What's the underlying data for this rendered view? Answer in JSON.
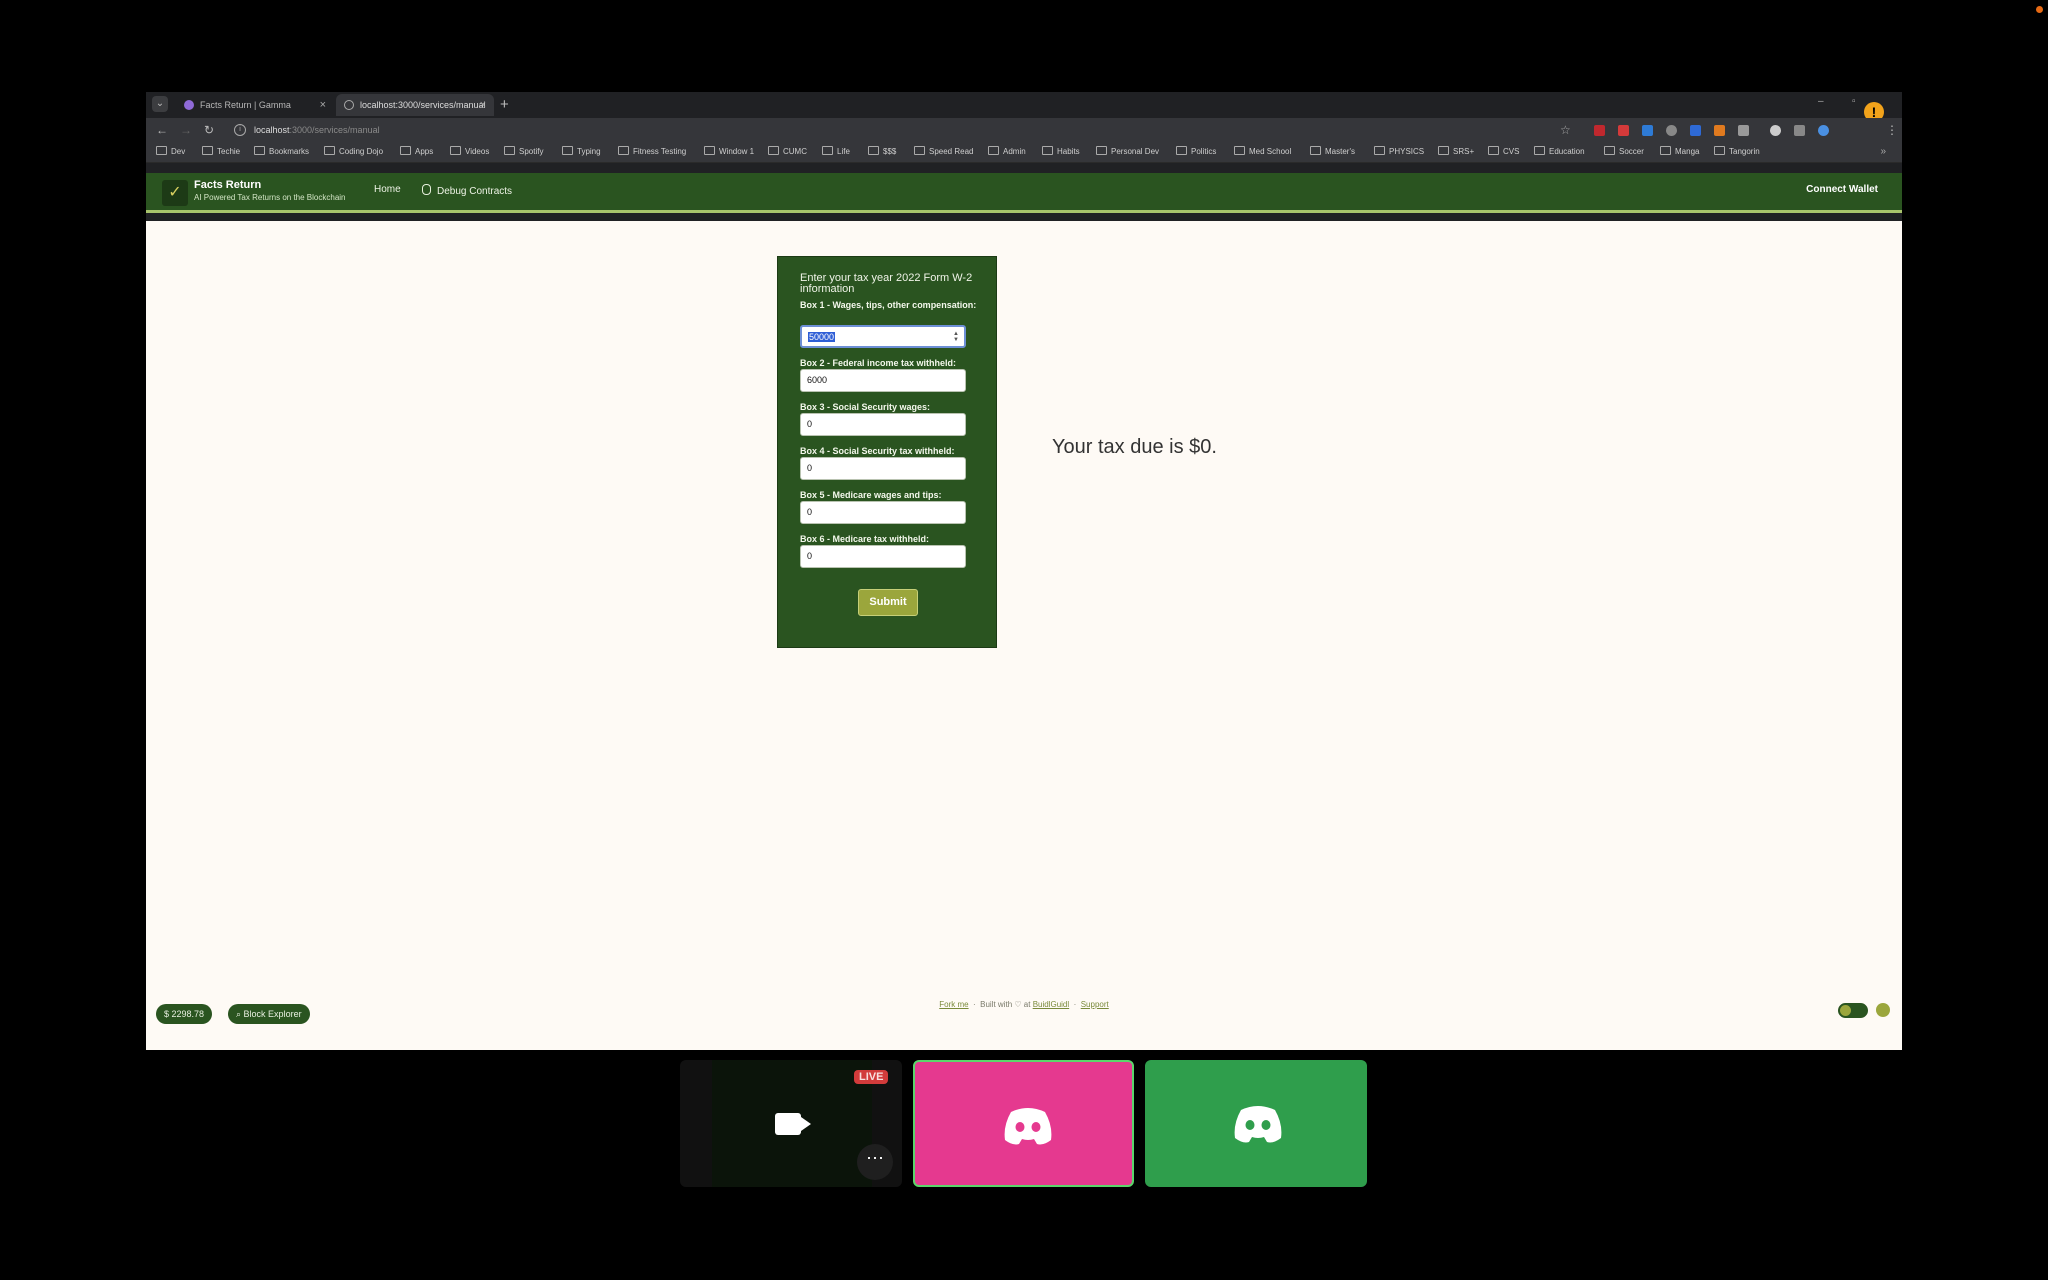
{
  "browser": {
    "tabs": [
      {
        "title": "Facts Return | Gamma"
      },
      {
        "title": "localhost:3000/services/manual"
      }
    ],
    "url_host": "localhost",
    "url_path": ":3000/services/manual",
    "bookmarks": [
      "Dev",
      "Techie",
      "Bookmarks",
      "Coding Dojo",
      "Apps",
      "Videos",
      "Spotify",
      "Typing",
      "Fitness Testing",
      "Window 1",
      "CUMC",
      "Life",
      "$$$",
      "Speed Read",
      "Admin",
      "Habits",
      "Personal Dev",
      "Politics",
      "Med School",
      "Master's",
      "PHYSICS",
      "SRS+",
      "CVS",
      "Education",
      "Soccer",
      "Manga",
      "Tangorin"
    ]
  },
  "app": {
    "brand": "Facts Return",
    "tagline": "AI Powered Tax Returns on the Blockchain",
    "nav": {
      "home": "Home",
      "debug": "Debug Contracts"
    },
    "connect_wallet": "Connect Wallet"
  },
  "form": {
    "intro": "Enter your tax year 2022 Form W-2 information",
    "fields": [
      {
        "label": "Box 1 - Wages, tips, other compensation:",
        "value": "50000"
      },
      {
        "label": "Box 2 - Federal income tax withheld:",
        "value": "6000"
      },
      {
        "label": "Box 3 - Social Security wages:",
        "value": "0"
      },
      {
        "label": "Box 4 - Social Security tax withheld:",
        "value": "0"
      },
      {
        "label": "Box 5 - Medicare wages and tips:",
        "value": "0"
      },
      {
        "label": "Box 6 - Medicare tax withheld:",
        "value": "0"
      }
    ],
    "submit": "Submit"
  },
  "result": "Your tax due is $0.",
  "footer": {
    "balance": "2298.78",
    "block_explorer": "Block Explorer",
    "fork_me": "Fork me",
    "built_with": "Built with ♡ at",
    "buidl": "BuidlGuidl",
    "support": "Support"
  },
  "call": {
    "live": "LIVE"
  },
  "colors": {
    "app_green": "#2a5420",
    "accent": "#9ba63c",
    "discord_pink": "#e5398f",
    "discord_green": "#2f9e4c"
  }
}
